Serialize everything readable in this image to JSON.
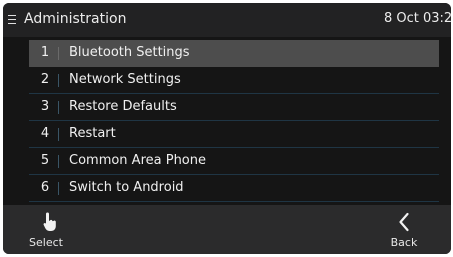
{
  "header": {
    "menu_icon": "hamburger-icon",
    "title": "Administration",
    "datetime": "8 Oct 03:2"
  },
  "menu": {
    "items": [
      {
        "number": "1",
        "label": "Bluetooth Settings",
        "selected": true
      },
      {
        "number": "2",
        "label": "Network Settings",
        "selected": false
      },
      {
        "number": "3",
        "label": "Restore Defaults",
        "selected": false
      },
      {
        "number": "4",
        "label": "Restart",
        "selected": false
      },
      {
        "number": "5",
        "label": "Common Area Phone",
        "selected": false
      },
      {
        "number": "6",
        "label": "Switch to Android",
        "selected": false
      }
    ]
  },
  "softkeys": {
    "select": {
      "label": "Select",
      "icon": "tap-hand-icon"
    },
    "back": {
      "label": "Back",
      "icon": "chevron-left-icon"
    }
  },
  "colors": {
    "background": "#151515",
    "header": "#222223",
    "selected_row": "#4d4d4d",
    "softkey_bar": "#2b2b2c",
    "row_divider": "#1f3544"
  }
}
